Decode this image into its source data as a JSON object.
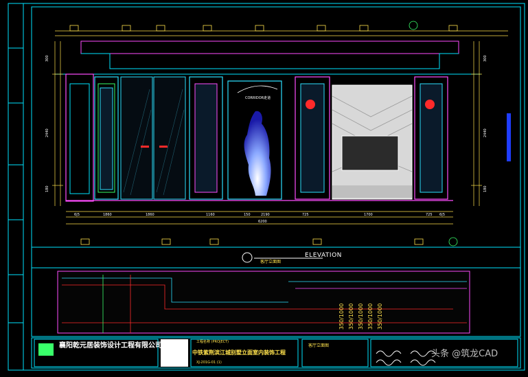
{
  "drawing": {
    "elevation_label": "ELEVATION",
    "elevation_subtitle": "客厅立面图",
    "corridor_label": "CORRIDOR走道",
    "total_dimension": "6200",
    "dimension_labels_bottom": [
      "6|5",
      "1860",
      "1860",
      "1160",
      "150",
      "2190",
      "725",
      "1700",
      "725",
      "6|5"
    ],
    "dimension_labels_left": [
      "300",
      "2440",
      "180"
    ],
    "dimension_labels_right": [
      "300",
      "2440",
      "180"
    ],
    "hatch_labels": [
      "350/1000",
      "350/1000",
      "350/1000",
      "350/1000",
      "350/1000"
    ]
  },
  "title_block": {
    "company": "襄阳乾元居装饰设计工程有限公司",
    "project_label": "工程名称 (PROJECT)",
    "project_name": "中铁紫荆滨江城别墅立面室内装饰工程",
    "drawing_no": "XJ-201G-01 (1)",
    "sheet_title": "客厅立面图"
  },
  "watermark": "头条 @筑龙CAD",
  "colors": {
    "background": "#000000",
    "frame": "#00e5ff",
    "annotation": "#ffe24d",
    "panel_outline": "#2ce0ff",
    "magenta": "#ff4dff",
    "red": "#ff2a2a",
    "green": "#39ff6a",
    "marble": "#d8d8d8"
  }
}
